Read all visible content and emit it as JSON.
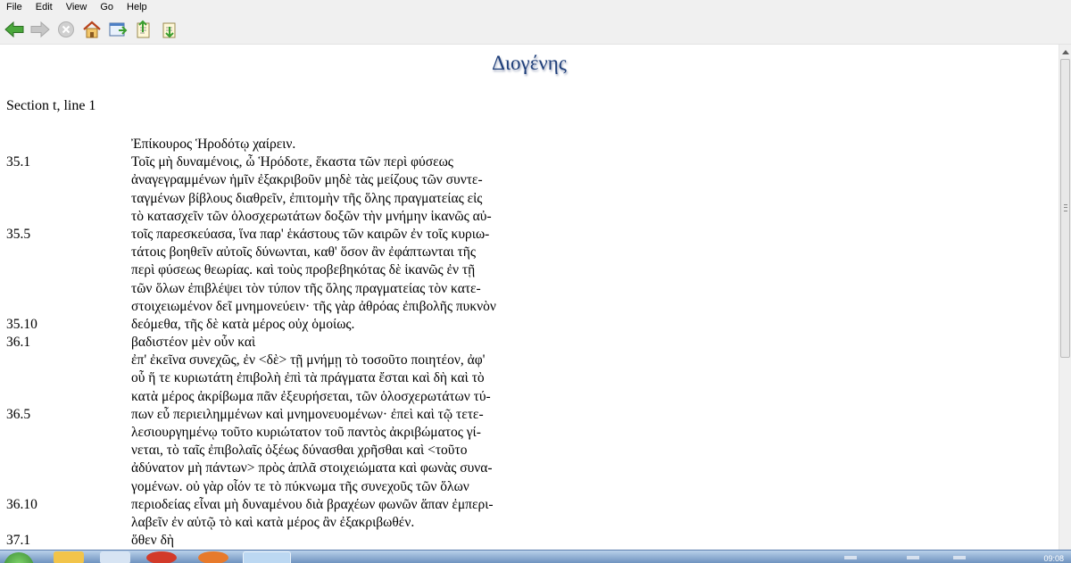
{
  "menubar": {
    "items": [
      "File",
      "Edit",
      "View",
      "Go",
      "Help"
    ]
  },
  "toolbar": {
    "buttons": [
      "back-arrow-icon",
      "forward-arrow-icon",
      "stop-icon",
      "home-icon",
      "new-window-icon",
      "export-icon",
      "import-icon"
    ]
  },
  "colors": {
    "title": "#1f3f7a",
    "chrome": "#f0f0f0",
    "accent_green": "#3a9d2f"
  },
  "document": {
    "title": "Διογένης",
    "section_label": "Section t, line 1",
    "lines": [
      {
        "ln": "",
        "text": "Ἐπίκουρος Ἡροδότῳ χαίρειν."
      },
      {
        "ln": "35.1",
        "text": " Τοῖς μὴ δυναμένοις, ὦ Ἡρόδοτε, ἕκαστα τῶν περὶ φύσεως"
      },
      {
        "ln": "",
        "text": "ἀναγεγραμμένων ἡμῖν ἐξακριβοῦν μηδὲ τὰς μείζους τῶν συντε-"
      },
      {
        "ln": "",
        "text": "ταγμένων βίβλους διαθρεῖν, ἐπιτομὴν τῆς ὅλης πραγματείας εἰς"
      },
      {
        "ln": "",
        "text": "τὸ κατασχεῖν τῶν ὁλοσχερωτάτων δοξῶν τὴν μνήμην ἱκανῶς αὐ-"
      },
      {
        "ln": "35.5",
        "text": "τοῖς παρεσκεύασα, ἵνα παρ' ἑκάστους τῶν καιρῶν ἐν τοῖς κυριω-"
      },
      {
        "ln": "",
        "text": "τάτοις βοηθεῖν αὐτοῖς δύνωνται, καθ' ὅσον ἂν ἐφάπτωνται τῆς"
      },
      {
        "ln": "",
        "text": "περὶ φύσεως θεωρίας. καὶ τοὺς προβεβηκότας δὲ ἱκανῶς ἐν τῇ"
      },
      {
        "ln": "",
        "text": "τῶν ὅλων ἐπιβλέψει τὸν τύπον τῆς ὅλης πραγματείας τὸν κατε-"
      },
      {
        "ln": "",
        "text": "στοιχειωμένον δεῖ μνημονεύειν· τῆς γὰρ ἀθρόας ἐπιβολῆς πυκνὸν"
      },
      {
        "ln": "35.10",
        "text": "δεόμεθα, τῆς δὲ κατὰ μέρος οὐχ ὁμοίως."
      },
      {
        "ln": "36.1",
        "text": "βαδιστέον μὲν οὖν καὶ"
      },
      {
        "ln": "",
        "text": "ἐπ' ἐκεῖνα συνεχῶς, ἐν <δὲ> τῇ μνήμῃ τὸ τοσοῦτο ποιητέον, ἀφ'"
      },
      {
        "ln": "",
        "text": "οὗ ἥ τε κυριωτάτη ἐπιβολὴ ἐπὶ τὰ πράγματα ἔσται καὶ δὴ καὶ τὸ"
      },
      {
        "ln": "",
        "text": "κατὰ μέρος ἀκρίβωμα πᾶν ἐξευρήσεται, τῶν ὁλοσχερωτάτων τύ-"
      },
      {
        "ln": "36.5",
        "text": "πων εὖ περιειλημμένων καὶ μνημονευομένων· ἐπεὶ καὶ τῷ τετε-"
      },
      {
        "ln": "",
        "text": "λεσιουργημένῳ τοῦτο κυριώτατον τοῦ παντὸς ἀκριβώματος γί-"
      },
      {
        "ln": "",
        "text": "νεται, τὸ ταῖς ἐπιβολαῖς ὀξέως δύνασθαι χρῆσθαι καὶ <τοῦτο"
      },
      {
        "ln": "",
        "text": "ἀδύνατον μὴ πάντων> πρὸς ἁπλᾶ στοιχειώματα καὶ φωνὰς συνα-"
      },
      {
        "ln": "",
        "text": "γομένων. οὐ γὰρ οἷόν τε τὸ πύκνωμα τῆς συνεχοῦς τῶν ὅλων"
      },
      {
        "ln": "36.10",
        "text": "περιοδείας εἶναι μὴ δυναμένου διὰ βραχέων φωνῶν ἅπαν ἐμπερι-"
      },
      {
        "ln": "",
        "text": "λαβεῖν ἐν αὑτῷ τὸ καὶ κατὰ μέρος ἂν ἐξακριβωθέν."
      },
      {
        "ln": "37.1",
        "text": "ὅθεν δὴ"
      }
    ]
  },
  "taskbar": {
    "clock": "09:08"
  }
}
